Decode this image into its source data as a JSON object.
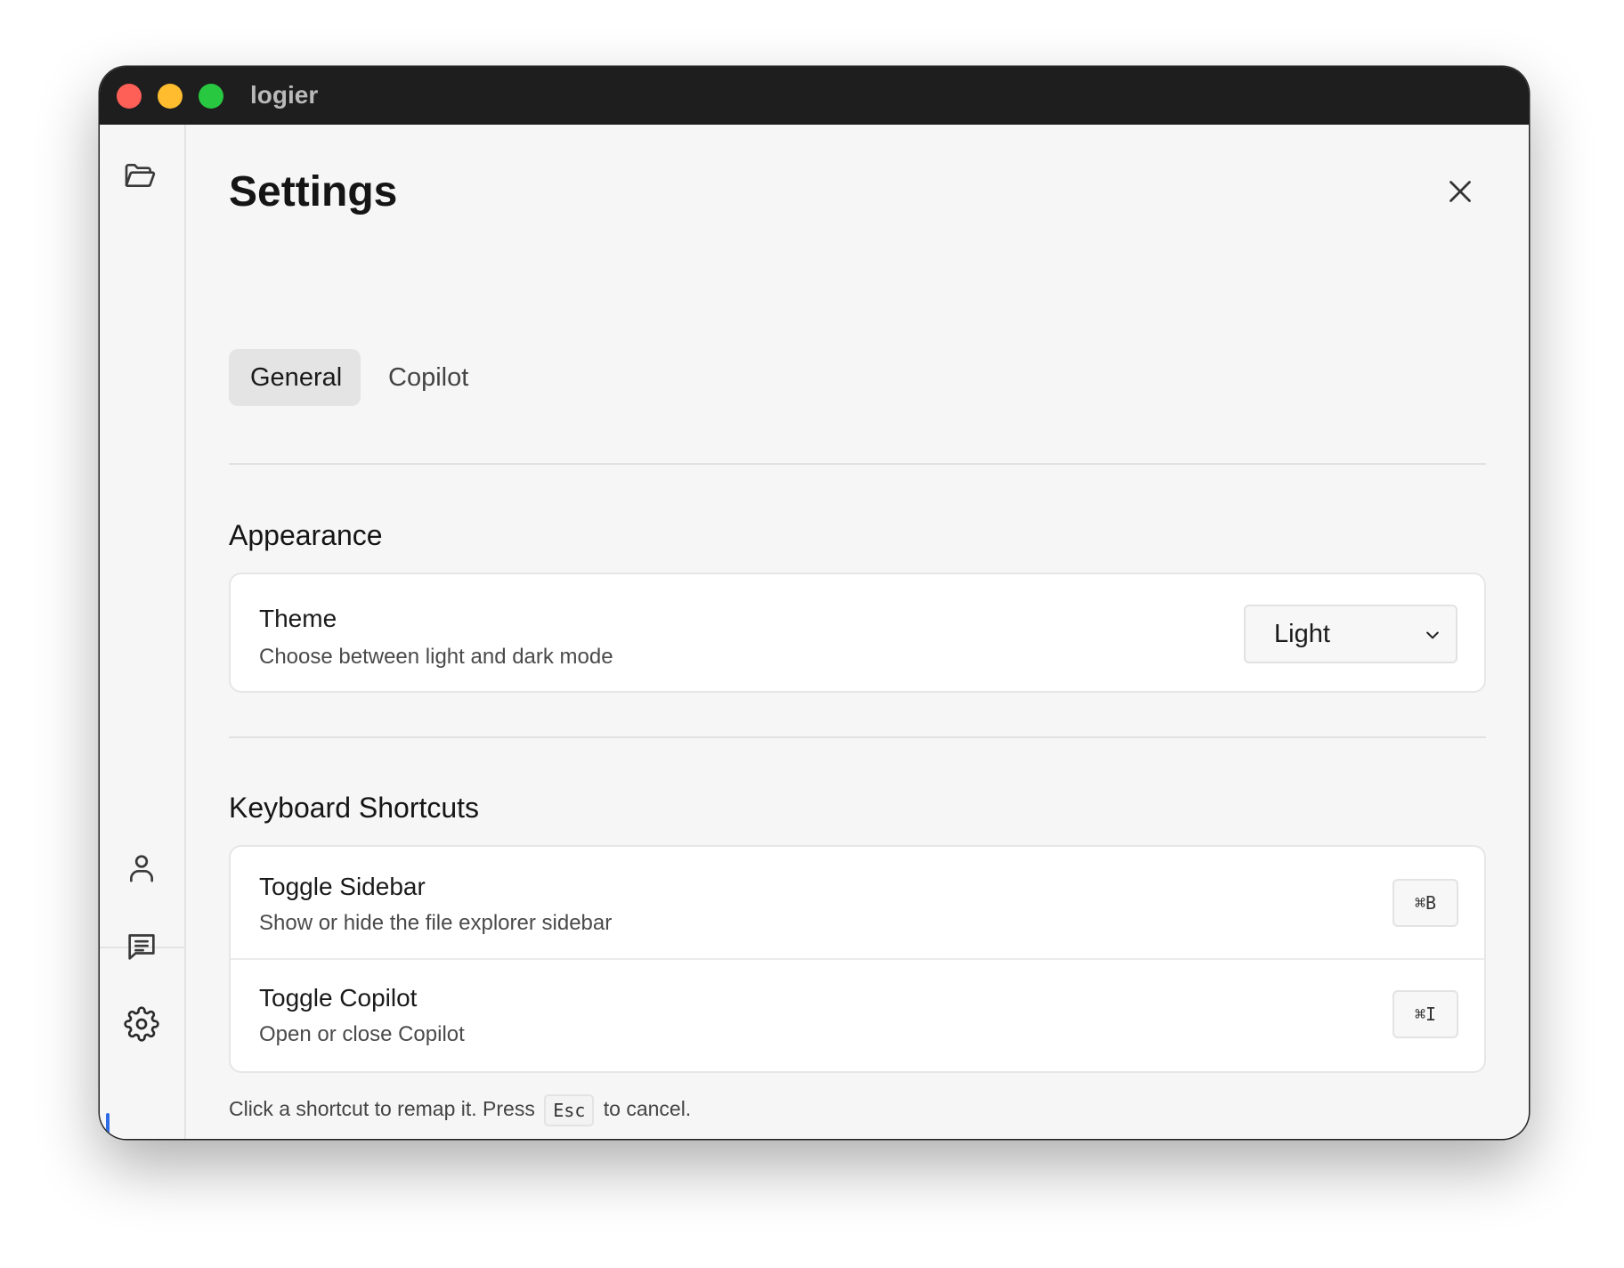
{
  "window": {
    "title": "logier"
  },
  "rail": {
    "items": [
      {
        "icon": "folder-open-icon"
      },
      {
        "icon": "user-icon"
      },
      {
        "icon": "chat-icon"
      },
      {
        "icon": "gear-icon",
        "active": true
      }
    ],
    "active_color": "#2e6be6"
  },
  "settings": {
    "title": "Settings",
    "tabs": [
      {
        "label": "General",
        "active": true
      },
      {
        "label": "Copilot",
        "active": false
      }
    ],
    "appearance": {
      "section_title": "Appearance",
      "theme": {
        "title": "Theme",
        "description": "Choose between light and dark mode",
        "selected": "Light"
      }
    },
    "shortcuts": {
      "section_title": "Keyboard Shortcuts",
      "items": [
        {
          "title": "Toggle Sidebar",
          "description": "Show or hide the file explorer sidebar",
          "key": "⌘B"
        },
        {
          "title": "Toggle Copilot",
          "description": "Open or close Copilot",
          "key": "⌘I"
        }
      ],
      "hint_before": "Click a shortcut to remap it. Press",
      "hint_key": "Esc",
      "hint_after": "to cancel."
    }
  }
}
